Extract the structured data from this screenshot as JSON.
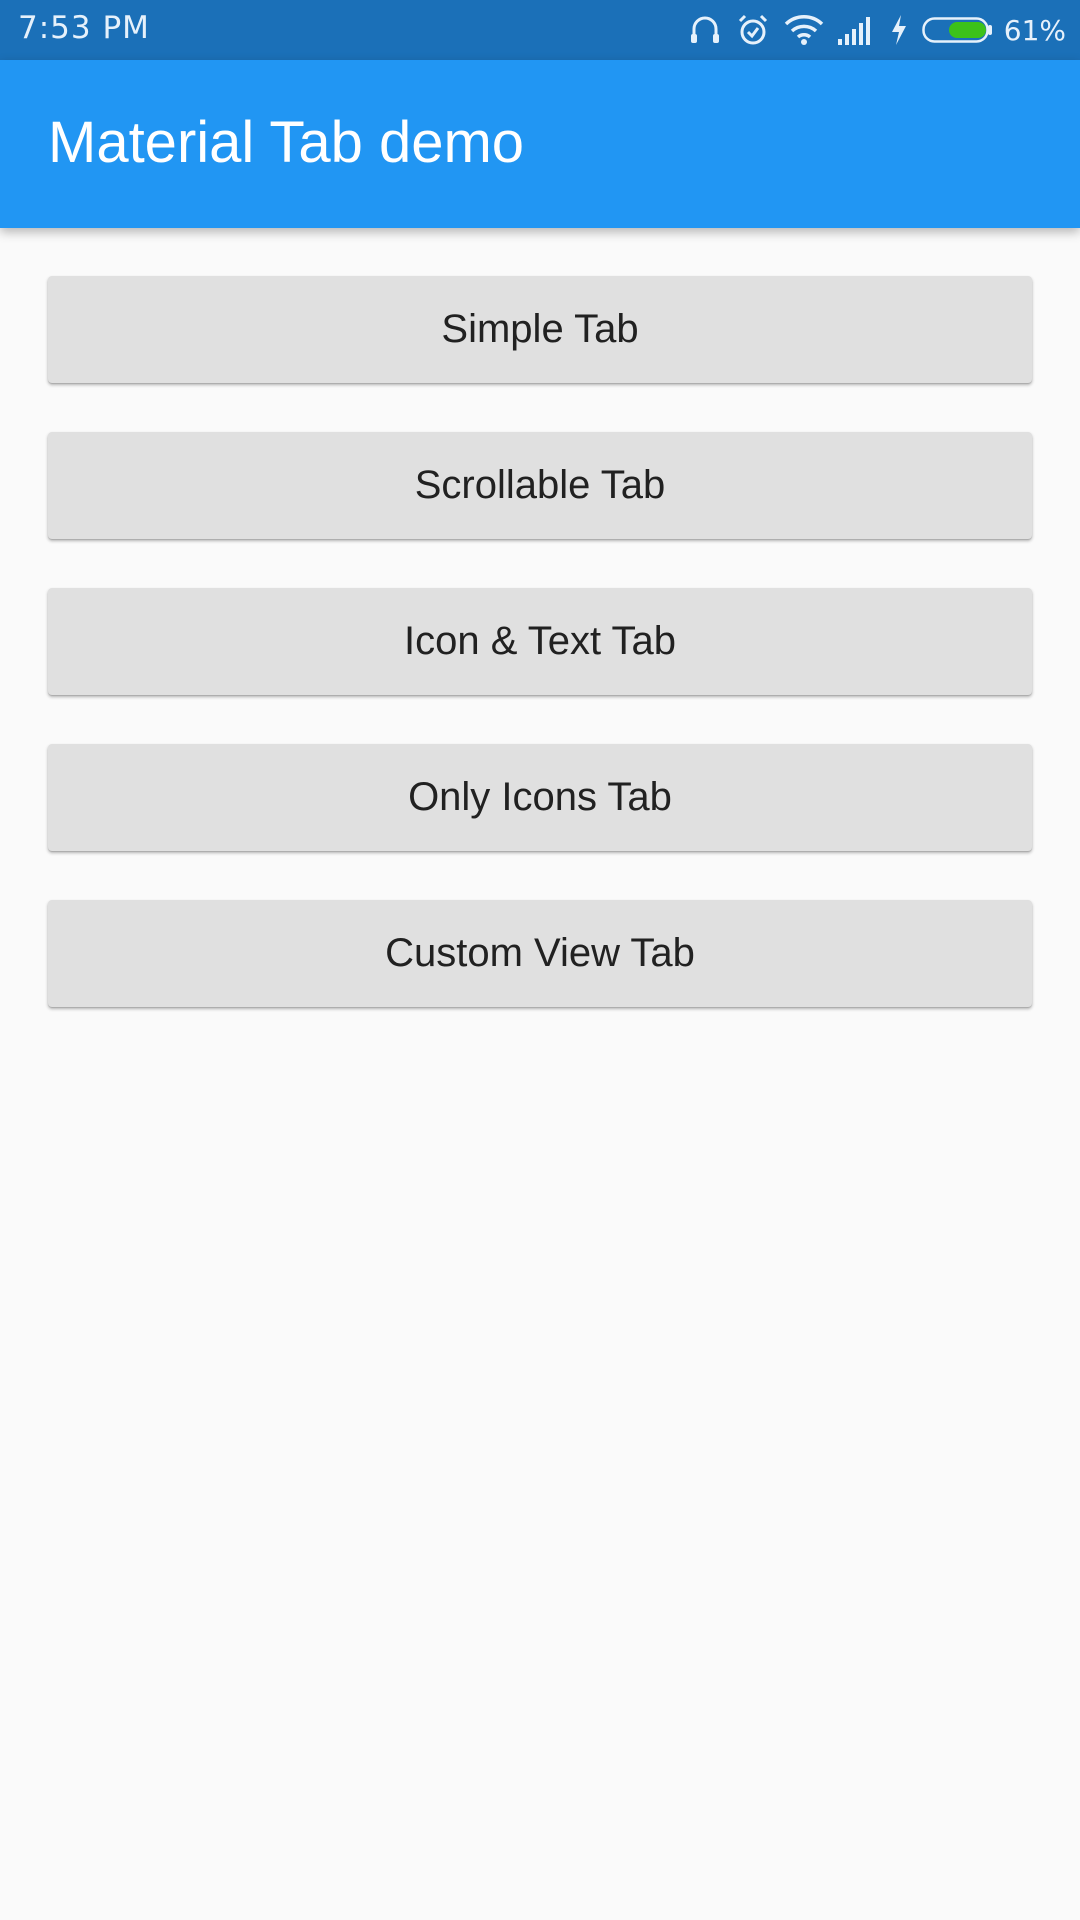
{
  "status_bar": {
    "time": "7:53 PM",
    "battery_percent": "61%",
    "battery_level": 0.61,
    "battery_color": "#3cc21a",
    "icons": [
      "headset-icon",
      "alarm-icon",
      "wifi-icon",
      "signal-icon",
      "charging-icon",
      "battery-icon"
    ]
  },
  "app_bar": {
    "title": "Material Tab demo",
    "color": "#2196f3"
  },
  "buttons": [
    {
      "label": "Simple Tab"
    },
    {
      "label": "Scrollable Tab"
    },
    {
      "label": "Icon & Text Tab"
    },
    {
      "label": "Only Icons Tab"
    },
    {
      "label": "Custom View Tab"
    }
  ]
}
